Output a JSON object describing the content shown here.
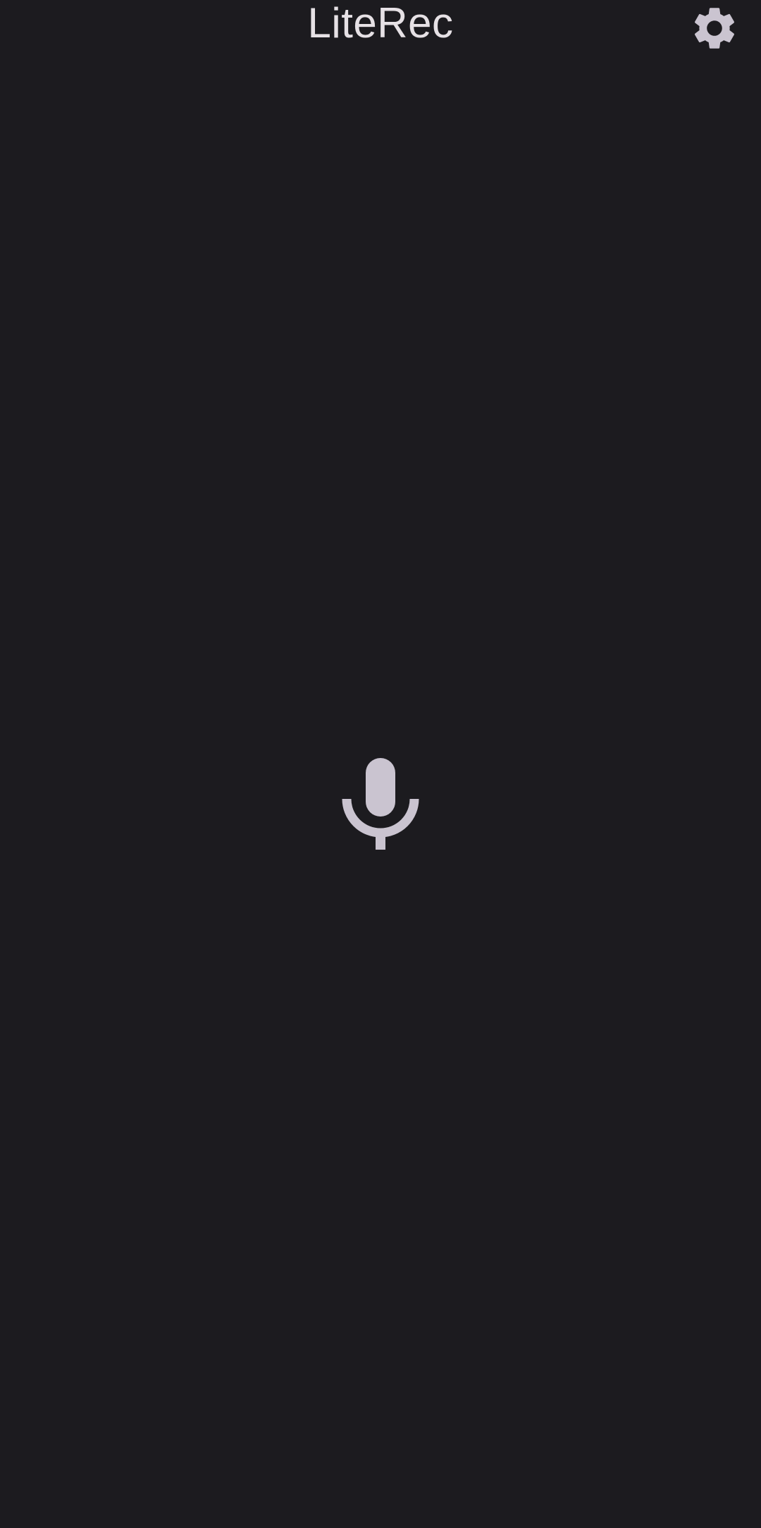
{
  "app": {
    "title": "LiteRec"
  },
  "icons": {
    "settings": "gear-icon",
    "record": "microphone-icon"
  },
  "colors": {
    "background": "#1c1b1f",
    "title_text": "#e6e1e5",
    "icon": "#cac4d0"
  }
}
